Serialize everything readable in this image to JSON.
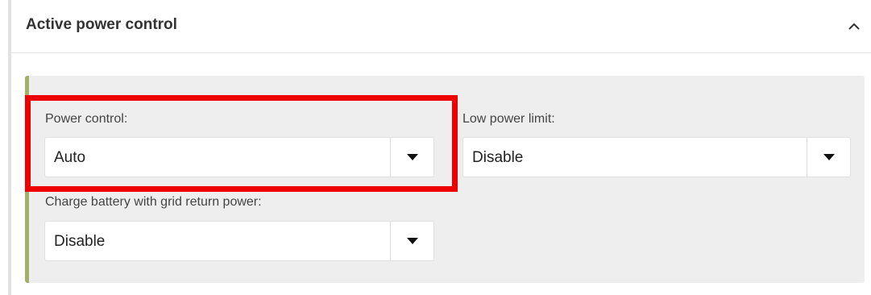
{
  "panel": {
    "title": "Active power control"
  },
  "icons": {
    "collapse": "chevron-up-icon",
    "dropdown": "caret-down-icon"
  },
  "fields": {
    "power_control": {
      "label": "Power control:",
      "value": "Auto"
    },
    "low_power_limit": {
      "label": "Low power limit:",
      "value": "Disable"
    },
    "charge_battery": {
      "label": "Charge battery with grid return power:",
      "value": "Disable"
    }
  },
  "colors": {
    "highlight": "#ee0000",
    "accent_border": "#a3b06a",
    "section_background": "#eeeeee"
  }
}
